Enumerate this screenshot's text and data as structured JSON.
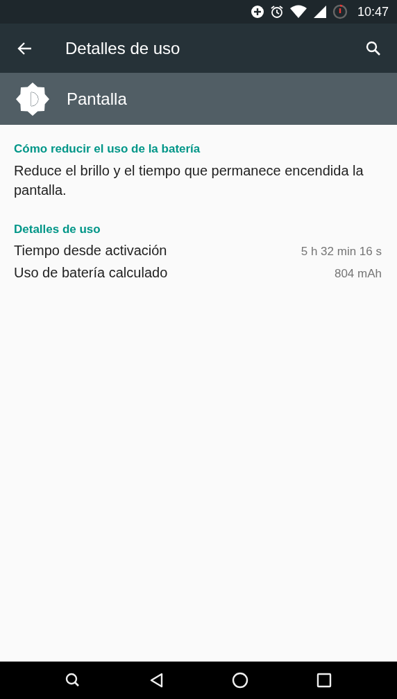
{
  "status_bar": {
    "time": "10:47"
  },
  "app_bar": {
    "title": "Detalles de uso"
  },
  "header": {
    "title": "Pantalla"
  },
  "sections": [
    {
      "kind": "text",
      "heading": "Cómo reducir el uso de la batería",
      "text": "Reduce el brillo y el tiempo que permanece encendida la pantalla."
    },
    {
      "kind": "rows",
      "heading": "Detalles de uso",
      "rows": [
        {
          "label": "Tiempo desde activación",
          "value": "5 h 32 min 16 s"
        },
        {
          "label": "Uso de batería calculado",
          "value": "804 mAh"
        }
      ]
    }
  ]
}
